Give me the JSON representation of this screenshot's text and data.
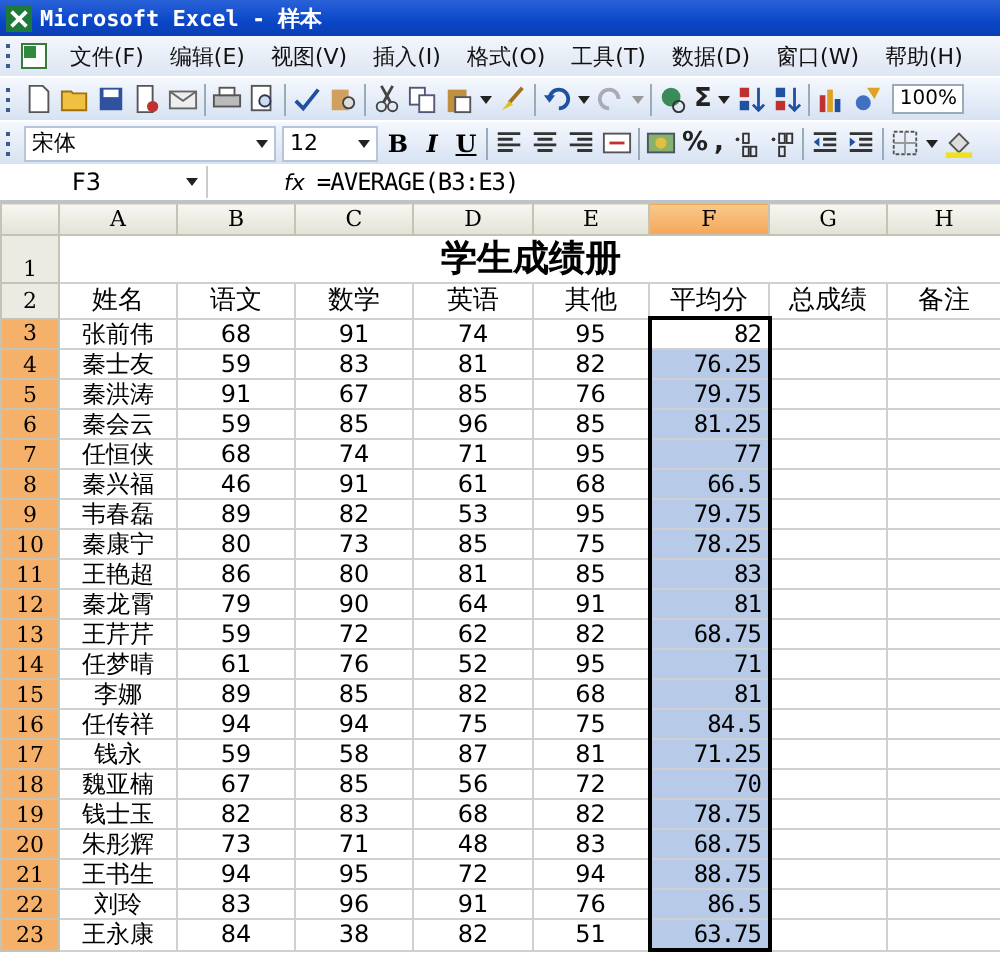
{
  "window": {
    "title": "Microsoft Excel - 样本"
  },
  "menu": [
    "文件(F)",
    "编辑(E)",
    "视图(V)",
    "插入(I)",
    "格式(O)",
    "工具(T)",
    "数据(D)",
    "窗口(W)",
    "帮助(H)"
  ],
  "standard_toolbar": {
    "sum": "Σ",
    "zoom": "100%"
  },
  "format_toolbar": {
    "font": "宋体",
    "size": "12",
    "bold": "B",
    "italic": "I",
    "underline": "U",
    "percent": "%",
    "comma": ","
  },
  "formula_bar": {
    "name_box": "F3",
    "fx": "fx",
    "formula": "=AVERAGE(B3:E3)"
  },
  "columns": [
    {
      "label": "A",
      "selected": false
    },
    {
      "label": "B",
      "selected": false
    },
    {
      "label": "C",
      "selected": false
    },
    {
      "label": "D",
      "selected": false
    },
    {
      "label": "E",
      "selected": false
    },
    {
      "label": "F",
      "selected": true
    },
    {
      "label": "G",
      "selected": false
    },
    {
      "label": "H",
      "selected": false
    }
  ],
  "title_row": {
    "num": "1",
    "title": "学生成绩册"
  },
  "header_row": {
    "num": "2",
    "cells": [
      "姓名",
      "语文",
      "数学",
      "英语",
      "其他",
      "平均分",
      "总成绩",
      "备注"
    ]
  },
  "rows": [
    {
      "num": "3",
      "selected": true,
      "active": true,
      "cells": [
        "张前伟",
        "68",
        "91",
        "74",
        "95",
        "82"
      ]
    },
    {
      "num": "4",
      "selected": true,
      "active": false,
      "cells": [
        "秦士友",
        "59",
        "83",
        "81",
        "82",
        "76.25"
      ]
    },
    {
      "num": "5",
      "selected": true,
      "active": false,
      "cells": [
        "秦洪涛",
        "91",
        "67",
        "85",
        "76",
        "79.75"
      ]
    },
    {
      "num": "6",
      "selected": true,
      "active": false,
      "cells": [
        "秦会云",
        "59",
        "85",
        "96",
        "85",
        "81.25"
      ]
    },
    {
      "num": "7",
      "selected": true,
      "active": false,
      "cells": [
        "任恒侠",
        "68",
        "74",
        "71",
        "95",
        "77"
      ]
    },
    {
      "num": "8",
      "selected": true,
      "active": false,
      "cells": [
        "秦兴福",
        "46",
        "91",
        "61",
        "68",
        "66.5"
      ]
    },
    {
      "num": "9",
      "selected": true,
      "active": false,
      "cells": [
        "韦春磊",
        "89",
        "82",
        "53",
        "95",
        "79.75"
      ]
    },
    {
      "num": "10",
      "selected": true,
      "active": false,
      "cells": [
        "秦康宁",
        "80",
        "73",
        "85",
        "75",
        "78.25"
      ]
    },
    {
      "num": "11",
      "selected": true,
      "active": false,
      "cells": [
        "王艳超",
        "86",
        "80",
        "81",
        "85",
        "83"
      ]
    },
    {
      "num": "12",
      "selected": true,
      "active": false,
      "cells": [
        "秦龙霄",
        "79",
        "90",
        "64",
        "91",
        "81"
      ]
    },
    {
      "num": "13",
      "selected": true,
      "active": false,
      "cells": [
        "王芹芹",
        "59",
        "72",
        "62",
        "82",
        "68.75"
      ]
    },
    {
      "num": "14",
      "selected": true,
      "active": false,
      "cells": [
        "任梦晴",
        "61",
        "76",
        "52",
        "95",
        "71"
      ]
    },
    {
      "num": "15",
      "selected": true,
      "active": false,
      "cells": [
        "李娜",
        "89",
        "85",
        "82",
        "68",
        "81"
      ]
    },
    {
      "num": "16",
      "selected": true,
      "active": false,
      "cells": [
        "任传祥",
        "94",
        "94",
        "75",
        "75",
        "84.5"
      ]
    },
    {
      "num": "17",
      "selected": true,
      "active": false,
      "cells": [
        "钱永",
        "59",
        "58",
        "87",
        "81",
        "71.25"
      ]
    },
    {
      "num": "18",
      "selected": true,
      "active": false,
      "cells": [
        "魏亚楠",
        "67",
        "85",
        "56",
        "72",
        "70"
      ]
    },
    {
      "num": "19",
      "selected": true,
      "active": false,
      "cells": [
        "钱士玉",
        "82",
        "83",
        "68",
        "82",
        "78.75"
      ]
    },
    {
      "num": "20",
      "selected": true,
      "active": false,
      "cells": [
        "朱彤辉",
        "73",
        "71",
        "48",
        "83",
        "68.75"
      ]
    },
    {
      "num": "21",
      "selected": true,
      "active": false,
      "cells": [
        "王书生",
        "94",
        "95",
        "72",
        "94",
        "88.75"
      ]
    },
    {
      "num": "22",
      "selected": true,
      "active": false,
      "cells": [
        "刘玲",
        "83",
        "96",
        "91",
        "76",
        "86.5"
      ]
    },
    {
      "num": "23",
      "selected": true,
      "active": false,
      "cells": [
        "王永康",
        "84",
        "38",
        "82",
        "51",
        "63.75"
      ]
    }
  ]
}
